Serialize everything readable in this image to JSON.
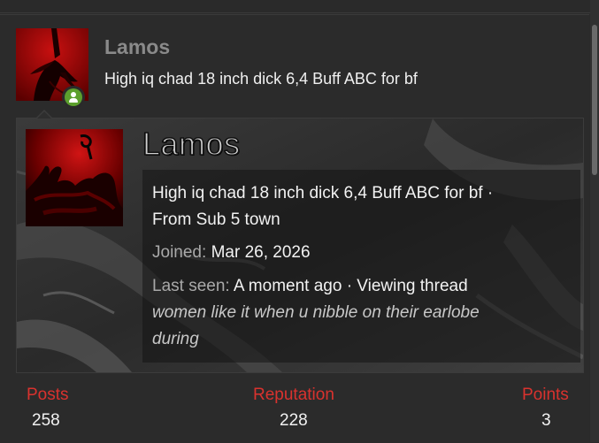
{
  "header": {
    "username": "Lamos",
    "user_title": "High iq chad 18 inch dick 6,4 Buff ABC for bf"
  },
  "icons": {
    "online_status": "user-online-icon"
  },
  "colors": {
    "stat_label": "#d9322e",
    "online": "#5c9f2d",
    "avatar_red": "#b30000"
  },
  "tooltip": {
    "username": "Lamos",
    "title_location": "High iq chad 18 inch dick 6,4 Buff ABC for bf · From Sub 5 town",
    "title_line1": "High iq chad 18 inch dick 6,4 Buff ABC for bf ·",
    "title_line2": "From Sub 5 town",
    "joined_label": "Joined:",
    "joined_value": "Mar 26, 2026",
    "last_seen_label": "Last seen:",
    "last_seen_value": "A moment ago · Viewing thread",
    "thread_line1": "women like it when u nibble on their earlobe",
    "thread_line2": "during"
  },
  "stats": [
    {
      "label": "Posts",
      "value": "258"
    },
    {
      "label": "Reputation",
      "value": "228"
    },
    {
      "label": "Points",
      "value": "3"
    }
  ]
}
